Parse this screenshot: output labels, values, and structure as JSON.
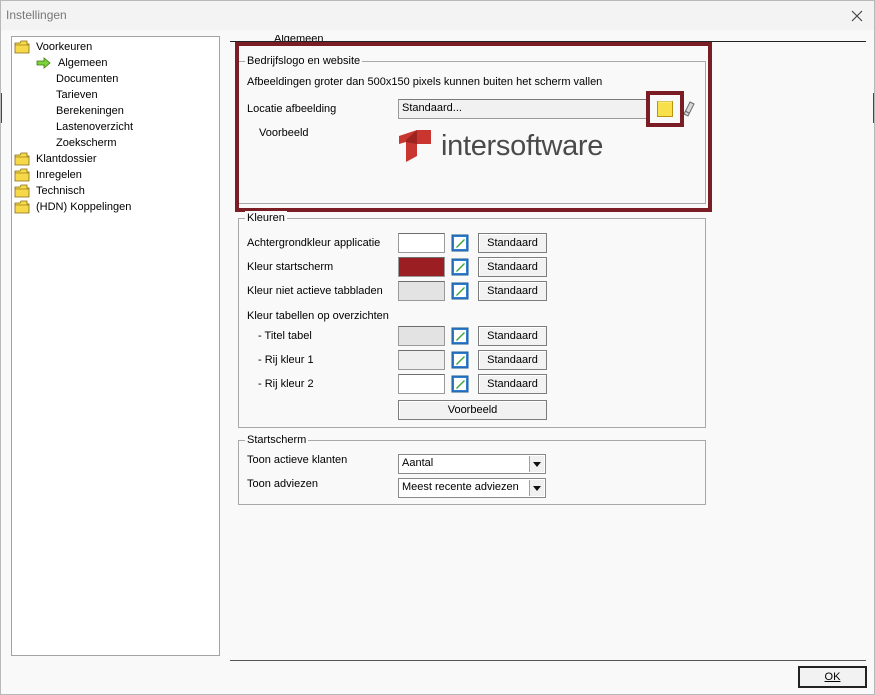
{
  "window": {
    "title": "Instellingen"
  },
  "tree": {
    "items": [
      {
        "label": "Voorkeuren",
        "icon": "folder-icon"
      },
      {
        "label": "Algemeen",
        "icon": "arrow-right-icon",
        "selected": true
      },
      {
        "label": "Documenten"
      },
      {
        "label": "Tarieven"
      },
      {
        "label": "Berekeningen"
      },
      {
        "label": "Lastenoverzicht"
      },
      {
        "label": "Zoekscherm"
      },
      {
        "label": "Klantdossier",
        "icon": "folder-icon"
      },
      {
        "label": "Inregelen",
        "icon": "folder-icon"
      },
      {
        "label": "Technisch",
        "icon": "folder-icon"
      },
      {
        "label": "(HDN) Koppelingen",
        "icon": "folder-icon"
      }
    ]
  },
  "tab": {
    "label": "Algemeen"
  },
  "logo_group": {
    "title": "Bedrijfslogo en website",
    "info": "Afbeeldingen groter dan 500x150 pixels kunnen buiten het scherm vallen",
    "location_label": "Locatie afbeelding",
    "location_value": "Standaard...",
    "preview_label": "Voorbeeld",
    "logo_text": "intersoftware",
    "highlight_color": "#7a1d24",
    "logo_color": "#c8362f"
  },
  "colors_group": {
    "title": "Kleuren",
    "rows": [
      {
        "label": "Achtergrondkleur applicatie",
        "color": "#ffffff",
        "button": "Standaard"
      },
      {
        "label": "Kleur startscherm",
        "color": "#9b1e22",
        "button": "Standaard"
      },
      {
        "label": "Kleur niet actieve tabbladen",
        "color": "#e3e3e3",
        "button": "Standaard"
      }
    ],
    "tables_heading": "Kleur tabellen op overzichten",
    "table_rows": [
      {
        "label": "- Titel tabel",
        "color": "#e3e3e3",
        "button": "Standaard"
      },
      {
        "label": "- Rij kleur 1",
        "color": "#eeeeee",
        "button": "Standaard"
      },
      {
        "label": "- Rij kleur 2",
        "color": "#ffffff",
        "button": "Standaard"
      }
    ],
    "preview_button": "Voorbeeld"
  },
  "start_group": {
    "title": "Startscherm",
    "rows": [
      {
        "label": "Toon actieve klanten",
        "value": "Aantal"
      },
      {
        "label": "Toon adviezen",
        "value": "Meest recente adviezen"
      }
    ]
  },
  "footer": {
    "ok_label": "OK"
  }
}
